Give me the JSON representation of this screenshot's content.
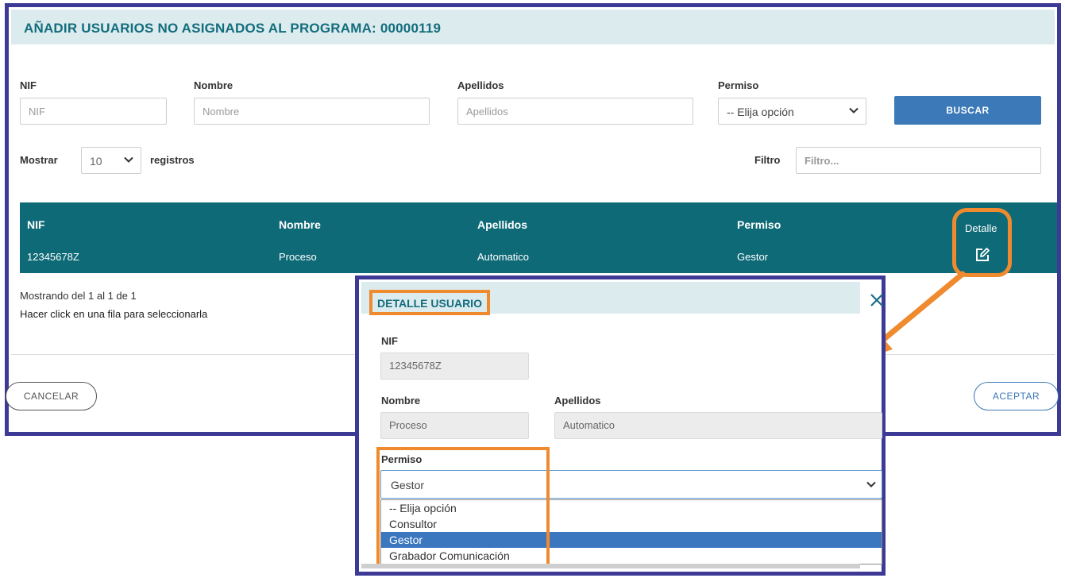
{
  "page": {
    "title": "AÑADIR USUARIOS NO ASIGNADOS AL PROGRAMA: 00000119"
  },
  "filters": {
    "nif_label": "NIF",
    "nif_placeholder": "NIF",
    "nombre_label": "Nombre",
    "nombre_placeholder": "Nombre",
    "apellidos_label": "Apellidos",
    "apellidos_placeholder": "Apellidos",
    "permiso_label": "Permiso",
    "permiso_value": "-- Elija opción",
    "buscar_label": "BUSCAR",
    "mostrar_label": "Mostrar",
    "page_size": "10",
    "registros_label": "registros",
    "filtro_label": "Filtro",
    "filtro_placeholder": "Filtro..."
  },
  "table": {
    "headers": [
      "NIF",
      "Nombre",
      "Apellidos",
      "Permiso",
      "Detalle"
    ],
    "rows": [
      [
        "12345678Z",
        "Proceso",
        "Automatico",
        "Gestor"
      ]
    ]
  },
  "info": {
    "showing": "Mostrando del 1 al 1 de 1",
    "hint": "Hacer click en una fila para seleccionarla"
  },
  "footer": {
    "cancel_label": "CANCELAR",
    "accept_label": "ACEPTAR"
  },
  "icons": {
    "edit": "edit-icon",
    "close": "close-icon",
    "chevron": "chevron-down-icon"
  },
  "colors": {
    "header_bg": "#dcebee",
    "title_teal": "#136d7d",
    "table_bg": "#0f6a77",
    "button_blue": "#3b79b8",
    "frame": "#3d3a96",
    "annotation": "#ef8a2f"
  },
  "modal": {
    "title": "DETALLE USUARIO",
    "nif_label": "NIF",
    "nif_value": "12345678Z",
    "nombre_label": "Nombre",
    "nombre_value": "Proceso",
    "apellidos_label": "Apellidos",
    "apellidos_value": "Automatico",
    "permiso_label": "Permiso",
    "permiso_value": "Gestor",
    "permiso_options": [
      "-- Elija opción",
      "Consultor",
      "Gestor",
      "Grabador Comunicación"
    ],
    "selected_option": "Gestor"
  }
}
